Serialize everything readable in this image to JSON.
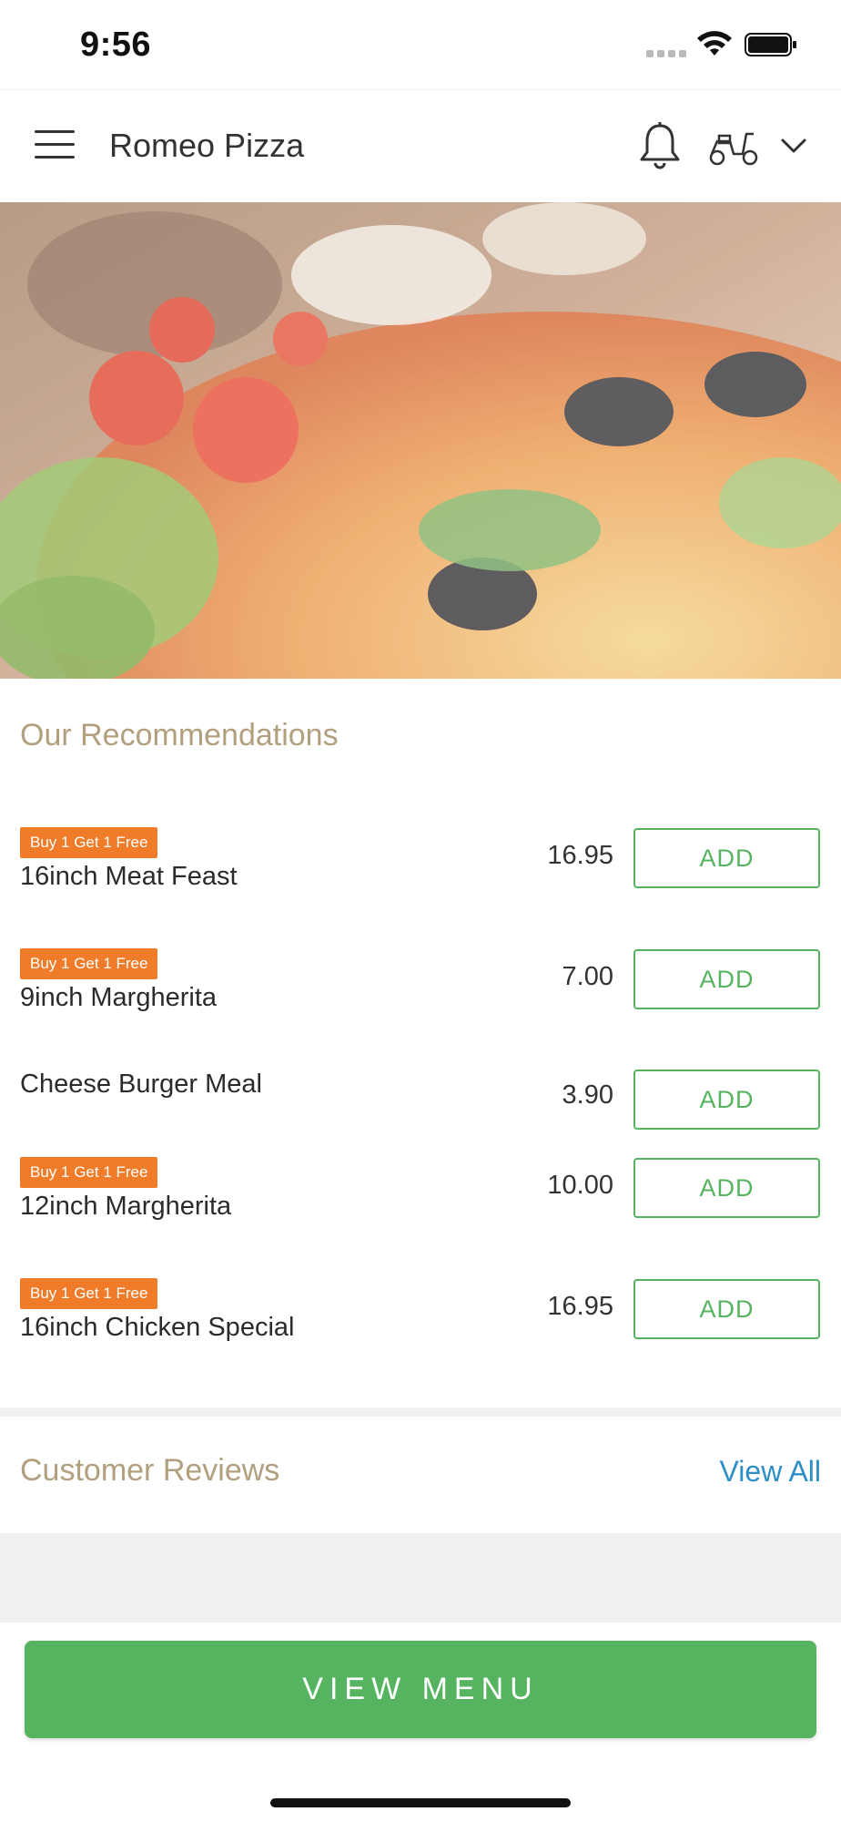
{
  "status_bar": {
    "time": "9:56"
  },
  "header": {
    "title": "Romeo Pizza",
    "icons": [
      "hamburger-menu-icon",
      "bell-icon",
      "scooter-icon",
      "chevron-down-icon"
    ]
  },
  "recommendations": {
    "title": "Our Recommendations",
    "items": [
      {
        "badge": "Buy 1 Get 1 Free",
        "name": "16inch Meat Feast",
        "price": "16.95",
        "button": "ADD"
      },
      {
        "badge": "Buy 1 Get 1 Free",
        "name": "9inch Margherita",
        "price": "7.00",
        "button": "ADD"
      },
      {
        "badge": "",
        "name": "Cheese Burger Meal",
        "price": "3.90",
        "button": "ADD"
      },
      {
        "badge": "Buy 1 Get 1 Free",
        "name": "12inch Margherita",
        "price": "10.00",
        "button": "ADD"
      },
      {
        "badge": "Buy 1 Get 1 Free",
        "name": "16inch Chicken Special",
        "price": "16.95",
        "button": "ADD"
      }
    ]
  },
  "reviews": {
    "title": "Customer Reviews",
    "view_all": "View All"
  },
  "bottom": {
    "view_menu": "VIEW MENU"
  },
  "colors": {
    "accent_green": "#56b35f",
    "badge_orange": "#f07c2a",
    "section_title": "#b19f7e",
    "link_blue": "#2d8fc6"
  }
}
